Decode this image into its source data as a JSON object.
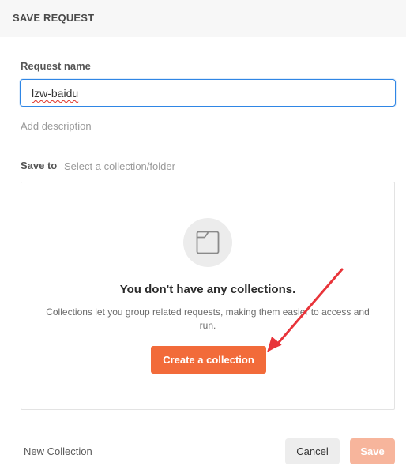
{
  "header": {
    "title": "SAVE REQUEST"
  },
  "form": {
    "request_name_label": "Request name",
    "request_name_value": "lzw-baidu",
    "add_description_link": "Add description",
    "save_to_label": "Save to",
    "save_to_placeholder": "Select a collection/folder"
  },
  "collections_empty": {
    "icon": "folder-icon",
    "title": "You don't have any collections.",
    "description": "Collections let you group related requests, making them easier to access and run.",
    "create_button": "Create a collection"
  },
  "footer": {
    "new_collection": "New Collection",
    "cancel": "Cancel",
    "save": "Save"
  },
  "colors": {
    "accent": "#f26b3a",
    "save_disabled": "#f7b59c",
    "focus_border": "#2f86e5",
    "annotation_arrow": "#e8343a"
  }
}
